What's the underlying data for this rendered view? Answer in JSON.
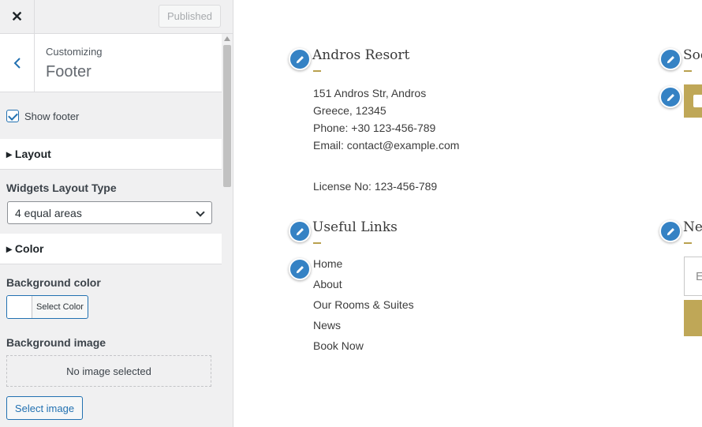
{
  "topbar": {
    "close_symbol": "✕",
    "published_label": "Published"
  },
  "section": {
    "back_symbol": "‹",
    "breadcrumb": "Customizing",
    "title": "Footer"
  },
  "controls": {
    "show_footer_label": "Show footer",
    "show_footer_checked": true,
    "layout_group": "▸ Layout",
    "widgets_layout_label": "Widgets Layout Type",
    "widgets_layout_value": "4 equal areas",
    "color_group": "▸ Color",
    "bg_color_label": "Background color",
    "select_color_label": "Select Color",
    "bg_image_label": "Background image",
    "no_image_text": "No image selected",
    "select_image_label": "Select image"
  },
  "preview": {
    "address_widget": {
      "title": "Andros Resort",
      "lines": [
        "151 Andros Str, Andros",
        "Greece, 12345",
        "Phone: +30 123-456-789",
        "Email: contact@example.com"
      ],
      "license": "License No: 123-456-789"
    },
    "social_widget": {
      "title": "Soc"
    },
    "links_widget": {
      "title": "Useful Links",
      "links": [
        "Home",
        "About",
        "Our Rooms & Suites",
        "News",
        "Book Now"
      ]
    },
    "newsletter_widget": {
      "title": "Ne",
      "email_placeholder": "E"
    }
  },
  "colors": {
    "accent_gold": "#bfa757",
    "edit_blue": "#3582c4",
    "wp_blue": "#2271b1"
  }
}
